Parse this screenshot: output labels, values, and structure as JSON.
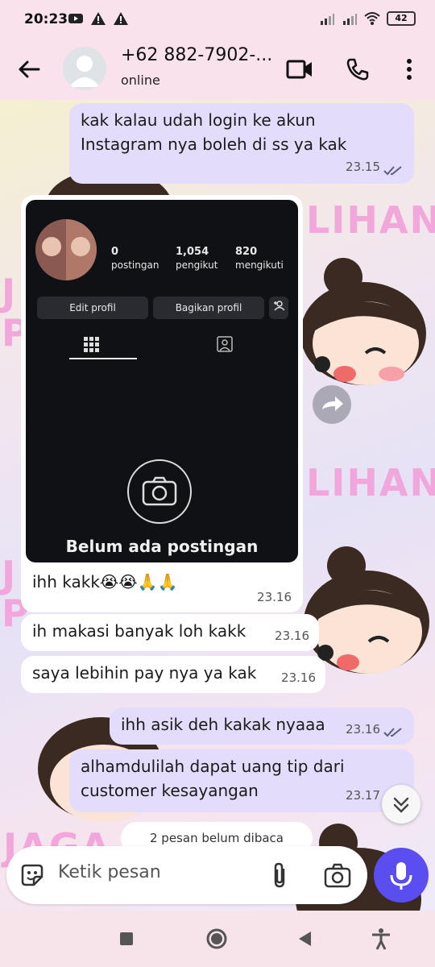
{
  "status_bar": {
    "time": "20:23",
    "battery": "42"
  },
  "header": {
    "contact_name": "+62 882-7902-...",
    "contact_status": "online"
  },
  "wallpaper": {
    "text_fragments": [
      "LIHAN",
      "J",
      "P",
      "LIHAN",
      "J",
      "P",
      "JAGA"
    ]
  },
  "messages": [
    {
      "type": "out",
      "lines": [
        "kak kalau udah login ke akun",
        "Instagram nya boleh di ss ya kak"
      ],
      "time": "23.15",
      "read": true
    },
    {
      "type": "in_image",
      "caption": "ihh kakk😭😭🙏🙏",
      "time": "23.16"
    },
    {
      "type": "in",
      "lines": [
        "ih makasi banyak loh kakk"
      ],
      "time": "23.16"
    },
    {
      "type": "in",
      "lines": [
        "saya lebihin pay nya ya kak"
      ],
      "time": "23.16"
    },
    {
      "type": "out",
      "lines": [
        "ihh asik deh kakak nyaaa"
      ],
      "time": "23.16",
      "read": true
    },
    {
      "type": "out",
      "lines": [
        "alhamdulilah dapat uang tip dari",
        "customer kesayangan"
      ],
      "time": "23.17",
      "read": true
    }
  ],
  "instagram_screenshot": {
    "stats": [
      {
        "number": "0",
        "label": "postingan"
      },
      {
        "number": "1,054",
        "label": "pengikut"
      },
      {
        "number": "820",
        "label": "mengikuti"
      }
    ],
    "edit_button": "Edit profil",
    "share_button": "Bagikan profil",
    "empty_text": "Belum ada postingan"
  },
  "unread_pill": "2 pesan belum dibaca",
  "composer": {
    "placeholder": "Ketik pesan"
  },
  "colors": {
    "accent": "#5b4ef0",
    "outgoing_bubble": "#e3dcfa",
    "incoming_bubble": "#ffffff",
    "read_ticks": "#5a5f80"
  }
}
